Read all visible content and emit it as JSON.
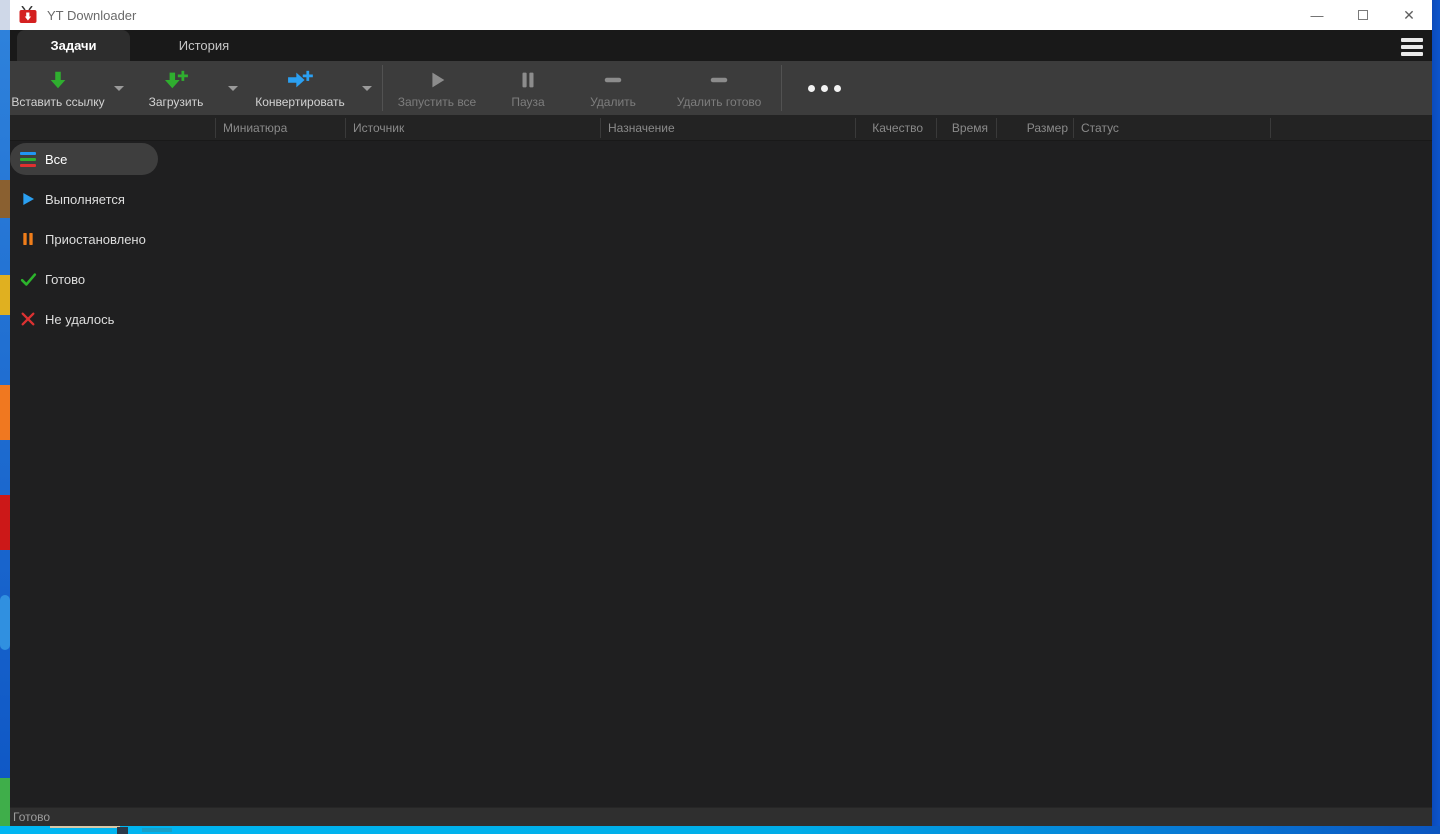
{
  "titlebar": {
    "title": "YT Downloader",
    "controls": {
      "minimize": "—",
      "close": "✕"
    }
  },
  "tabs": {
    "tasks": "Задачи",
    "history": "История"
  },
  "toolbar": {
    "paste_link": "Вставить ссылку",
    "download": "Загрузить",
    "convert": "Конвертировать",
    "start_all": "Запустить все",
    "pause": "Пауза",
    "delete": "Удалить",
    "delete_done": "Удалить готово"
  },
  "table": {
    "columns": [
      "Миниатюра",
      "Источник",
      "Назначение",
      "Качество",
      "Время",
      "Размер",
      "Статус"
    ],
    "rows": []
  },
  "sidebar": {
    "items": [
      {
        "label": "Все",
        "icon": "list-all-icon",
        "selected": true
      },
      {
        "label": "Выполняется",
        "icon": "play-icon",
        "selected": false
      },
      {
        "label": "Приостановлено",
        "icon": "pause-icon",
        "selected": false
      },
      {
        "label": "Готово",
        "icon": "check-icon",
        "selected": false
      },
      {
        "label": "Не удалось",
        "icon": "cross-icon",
        "selected": false
      }
    ]
  },
  "statusbar": {
    "text": "Готово"
  },
  "colors": {
    "accent_green": "#2fae2f",
    "accent_blue": "#2ba0f2",
    "paused_orange": "#ef7d1a",
    "failed_red": "#dc3232",
    "list_blue": "#2196f3",
    "list_green": "#30b030",
    "list_red": "#e03030",
    "desktop_blue": "#1560c8",
    "taskbar_cyan": "#00aee8"
  }
}
